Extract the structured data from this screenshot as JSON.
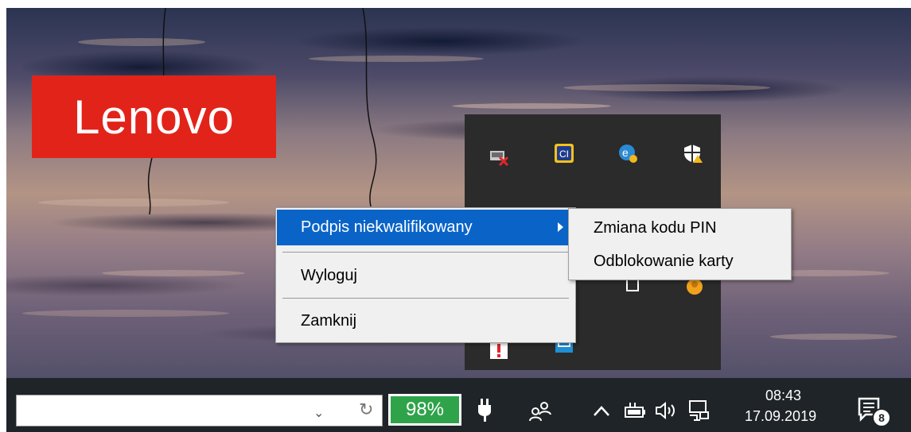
{
  "brand": {
    "logo_text": "Lenovo"
  },
  "context_menu": {
    "items": [
      {
        "label": "Podpis niekwalifikowany",
        "has_submenu": true,
        "highlighted": true
      },
      {
        "label": "Wyloguj"
      },
      {
        "label": "Zamknij"
      }
    ]
  },
  "submenu": {
    "items": [
      {
        "label": "Zmiana kodu PIN"
      },
      {
        "label": "Odblokowanie karty"
      }
    ]
  },
  "tray_popup": {
    "icons": [
      "network-error-icon",
      "ci-app-icon",
      "edge-warning-icon",
      "security-shield-warning-icon",
      "copy-icon",
      "avatar-orange-icon",
      "alert-icon",
      "blue-app-icon"
    ]
  },
  "taskbar": {
    "search_value": "",
    "battery_percent": "98%",
    "time": "08:43",
    "date": "17.09.2019",
    "notification_count": "8"
  },
  "colors": {
    "lenovo_red": "#e2231a",
    "menu_highlight": "#0a64c8",
    "battery_green": "#2fa34a",
    "taskbar": "#1f2428"
  }
}
